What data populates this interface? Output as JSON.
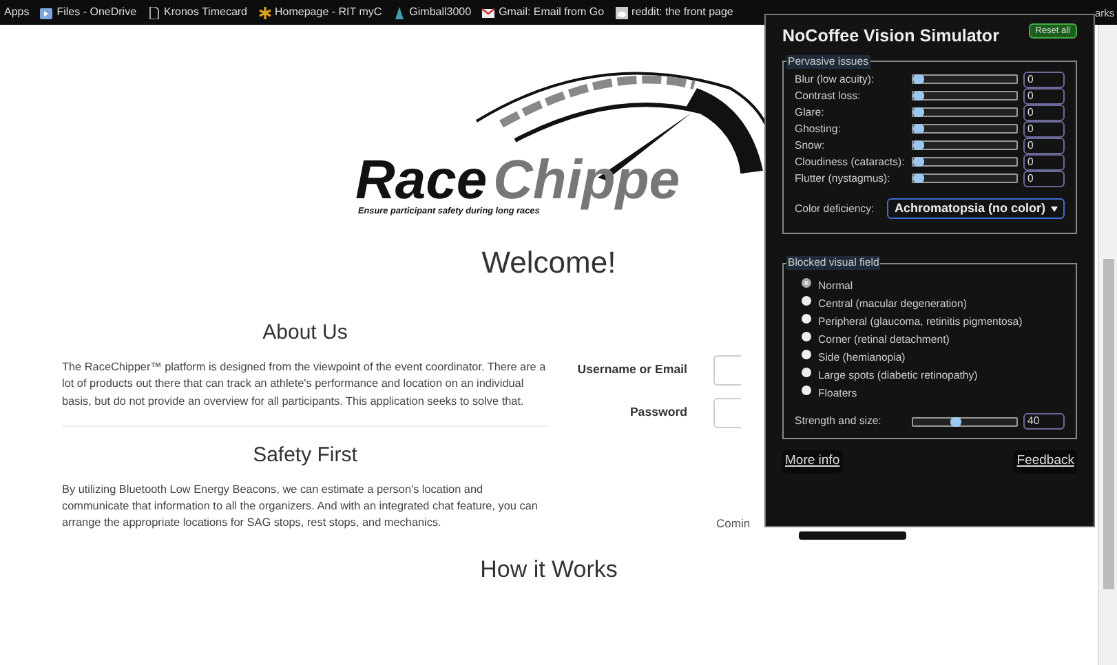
{
  "bookmarks_bar": {
    "items": [
      {
        "label": "Apps",
        "kind": "apps"
      },
      {
        "label": "Files - OneDrive",
        "kind": "cloud"
      },
      {
        "label": "Kronos Timecard",
        "kind": "page"
      },
      {
        "label": "Homepage - RIT myC",
        "kind": "star"
      },
      {
        "label": "Gimball3000",
        "kind": "sail"
      },
      {
        "label": "Gmail: Email from Go",
        "kind": "mail"
      },
      {
        "label": "reddit: the front page",
        "kind": "alien"
      }
    ],
    "overflow": "arks"
  },
  "logo": {
    "word_1": "Race",
    "word_2": "Chippe",
    "tagline": "Ensure participant safety during long races"
  },
  "heading": "Welcome!",
  "sections": [
    {
      "title": "About Us",
      "text": "The RaceChipper™ platform is designed from the viewpoint of the event coordinator. There are a lot of products out there that can track an athlete's performance and location on an individual basis, but do not provide an overview for all participants. This application seeks to solve that."
    },
    {
      "title": "Safety First",
      "text": "By utilizing Bluetooth Low Energy Beacons, we can estimate a person's location and communicate that information to all the organizers. And with an integrated chat feature, you can arrange the appropriate locations for SAG stops, rest stops, and mechanics."
    }
  ],
  "login": {
    "fields": [
      {
        "label": "Username or Email"
      },
      {
        "label": "Password"
      }
    ],
    "note": "Comin"
  },
  "footer_heading": "How it Works",
  "simulator": {
    "title": "NoCoffee Vision Simulator",
    "reset_button": "Reset all",
    "pervasive": {
      "legend": "Pervasive issues",
      "rows": [
        {
          "label": "Blur (low acuity):",
          "level": 0,
          "value": "0"
        },
        {
          "label": "Contrast loss:",
          "level": 0,
          "value": "0"
        },
        {
          "label": "Glare:",
          "level": 0,
          "value": "0"
        },
        {
          "label": "Ghosting:",
          "level": 0,
          "value": "0"
        },
        {
          "label": "Snow:",
          "level": 0,
          "value": "0"
        },
        {
          "label": "Cloudiness (cataracts):",
          "level": 0,
          "value": "0"
        },
        {
          "label": "Flutter (nystagmus):",
          "level": 0,
          "value": "0"
        }
      ],
      "color_label": "Color deficiency:",
      "color_value": "Achromatopsia (no color)"
    },
    "blocked": {
      "legend": "Blocked visual field",
      "options": [
        {
          "label": "Normal",
          "selected": true
        },
        {
          "label": "Central (macular degeneration)",
          "selected": false
        },
        {
          "label": "Peripheral (glaucoma, retinitis pigmentosa)",
          "selected": false
        },
        {
          "label": "Corner (retinal detachment)",
          "selected": false
        },
        {
          "label": "Side (hemianopia)",
          "selected": false
        },
        {
          "label": "Large spots (diabetic retinopathy)",
          "selected": false
        },
        {
          "label": "Floaters",
          "selected": false
        }
      ],
      "strength": {
        "label": "Strength and size:",
        "level": 0.4,
        "value": "40"
      }
    },
    "links": [
      "More info",
      "Feedback"
    ]
  }
}
